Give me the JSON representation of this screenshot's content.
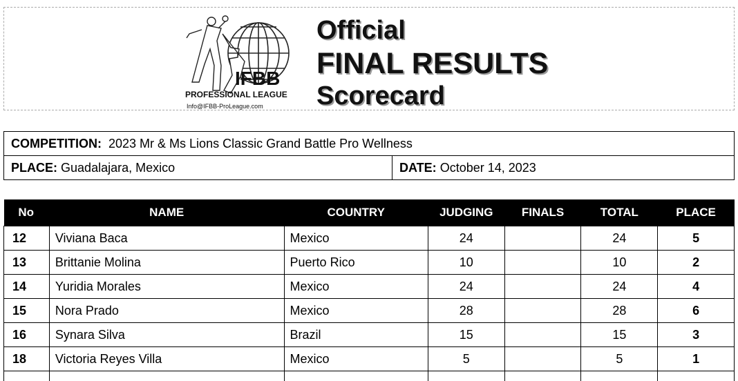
{
  "header": {
    "logo": {
      "brand": "IFBB",
      "league": "PROFESSIONAL LEAGUE",
      "email": "Info@IFBB-ProLeague.com"
    },
    "title_lines": [
      "Official",
      "FINAL RESULTS",
      "Scorecard"
    ]
  },
  "info": {
    "competition_label": "COMPETITION",
    "competition_value": "2023 Mr & Ms Lions Classic Grand Battle Pro Wellness",
    "place_label": "PLACE",
    "place_value": "Guadalajara, Mexico",
    "date_label": "DATE",
    "date_value": "October 14, 2023"
  },
  "table": {
    "headers": {
      "no": "No",
      "name": "NAME",
      "country": "COUNTRY",
      "judging": "JUDGING",
      "finals": "FINALS",
      "total": "TOTAL",
      "place": "PLACE"
    },
    "rows": [
      {
        "no": "12",
        "name": "Viviana Baca",
        "country": "Mexico",
        "judging": "24",
        "finals": "",
        "total": "24",
        "place": "5"
      },
      {
        "no": "13",
        "name": "Brittanie Molina",
        "country": "Puerto Rico",
        "judging": "10",
        "finals": "",
        "total": "10",
        "place": "2"
      },
      {
        "no": "14",
        "name": "Yuridia Morales",
        "country": "Mexico",
        "judging": "24",
        "finals": "",
        "total": "24",
        "place": "4"
      },
      {
        "no": "15",
        "name": "Nora Prado",
        "country": "Mexico",
        "judging": "28",
        "finals": "",
        "total": "28",
        "place": "6"
      },
      {
        "no": "16",
        "name": "Synara Silva",
        "country": "Brazil",
        "judging": "15",
        "finals": "",
        "total": "15",
        "place": "3"
      },
      {
        "no": "18",
        "name": "Victoria Reyes Villa",
        "country": "Mexico",
        "judging": "5",
        "finals": "",
        "total": "5",
        "place": "1"
      }
    ]
  }
}
